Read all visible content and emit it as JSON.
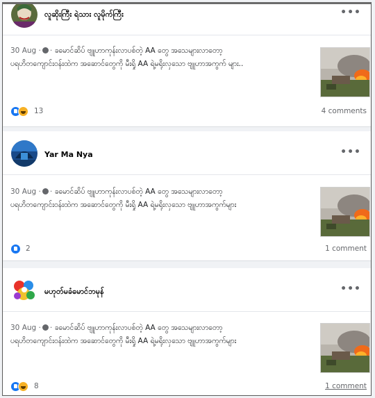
{
  "posts": [
    {
      "author": "လူဆိုးကြီး ရဲသား လူမိုက်ကြီး",
      "date": "30 Aug",
      "sep": "·",
      "line1": "ခမောင်ဆိပ် ဗျူဟာကုန်းလာပစ်တဲ့ AA တွေ အသေများလာတော့",
      "line2": "ပရဟိတကျောင်းဝန်းထဲက အဆောင်တွေကို မီးရှို AA ရဲ့မရိုးလှသော ဗျူဟာအကွက် များ..",
      "reactions": [
        "like",
        "haha"
      ],
      "reaction_count": "13",
      "comments": "4 comments"
    },
    {
      "author": "Yar Ma Nya",
      "date": "30 Aug",
      "sep": "·",
      "line1": "ခမောင်ဆိပ် ဗျူဟာကုန်းလာပစ်တဲ့ AA တွေ အသေများလာတော့",
      "line2": "ပရဟိတကျောင်းဝန်းထဲက အဆောင်တွေကို မီးရှို AA ရဲ့မရိုးလှသော ဗျူဟာအကွက်များ",
      "reactions": [
        "like"
      ],
      "reaction_count": "2",
      "comments": "1 comment"
    },
    {
      "author": "မဟုတ်မခံမောင်ဘမုန်",
      "date": "30 Aug",
      "sep": "·",
      "line1": "ခမောင်ဆိပ် ဗျူဟာကုန်းလာပစ်တဲ့ AA တွေ အသေများလာတော့",
      "line2": "ပရဟိတကျောင်းဝန်းထဲက အဆောင်တွေကို မီးရှို AA ရဲ့မရိုးလှသော ဗျူဟာအကွက်များ",
      "reactions": [
        "like",
        "haha"
      ],
      "reaction_count": "8",
      "comments": "1 comment"
    }
  ],
  "more_glyph": "•••",
  "colors": {
    "like": "#1877f2",
    "haha": "#f7b125",
    "meta": "#65676b"
  },
  "icons": [
    "globe-icon",
    "like-reaction-icon",
    "haha-reaction-icon",
    "more-options-icon"
  ]
}
